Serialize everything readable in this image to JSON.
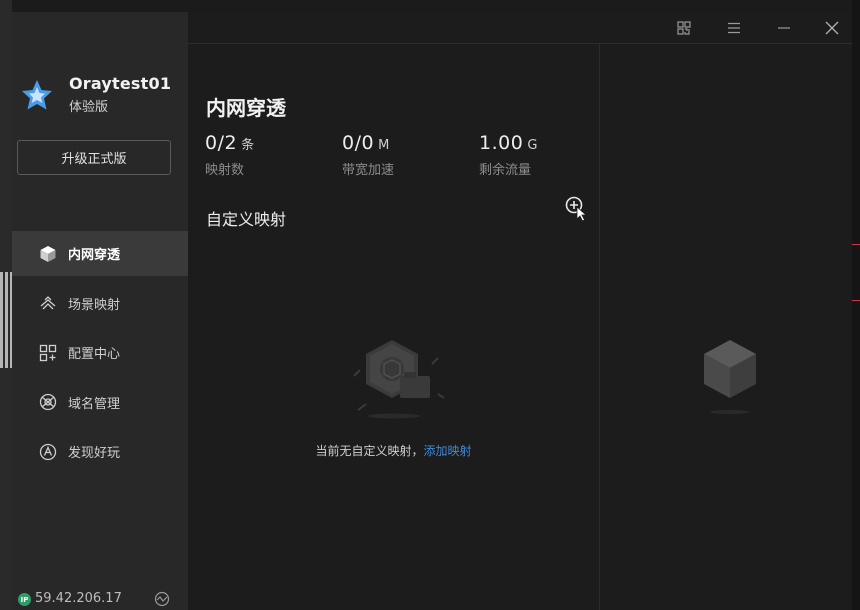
{
  "user": {
    "name": "Oraytest01",
    "edition": "体验版"
  },
  "sidebar": {
    "upgrade_label": "升级正式版",
    "items": [
      {
        "label": "内网穿透",
        "icon": "cube-icon",
        "active": true
      },
      {
        "label": "场景映射",
        "icon": "scene-icon",
        "active": false
      },
      {
        "label": "配置中心",
        "icon": "grid-icon",
        "active": false
      },
      {
        "label": "域名管理",
        "icon": "domain-icon",
        "active": false
      },
      {
        "label": "发现好玩",
        "icon": "compass-icon",
        "active": false
      }
    ]
  },
  "footer": {
    "ip_badge": "IP",
    "ip": "59.42.206.17"
  },
  "main": {
    "title": "内网穿透",
    "stats": [
      {
        "value": "0/2",
        "unit": "条",
        "label": "映射数"
      },
      {
        "value": "0/0",
        "unit": "M",
        "label": "带宽加速"
      },
      {
        "value": "1.00",
        "unit": "G",
        "label": "剩余流量"
      }
    ],
    "section_title": "自定义映射",
    "empty_text": "当前无自定义映射，",
    "empty_link": "添加映射"
  },
  "colors": {
    "accent": "#3f88d6",
    "sidebar_bg": "#282828",
    "window_bg": "#1c1c1c",
    "active_item_bg": "#3a3a3a",
    "ip_badge": "#2e9d6a"
  }
}
